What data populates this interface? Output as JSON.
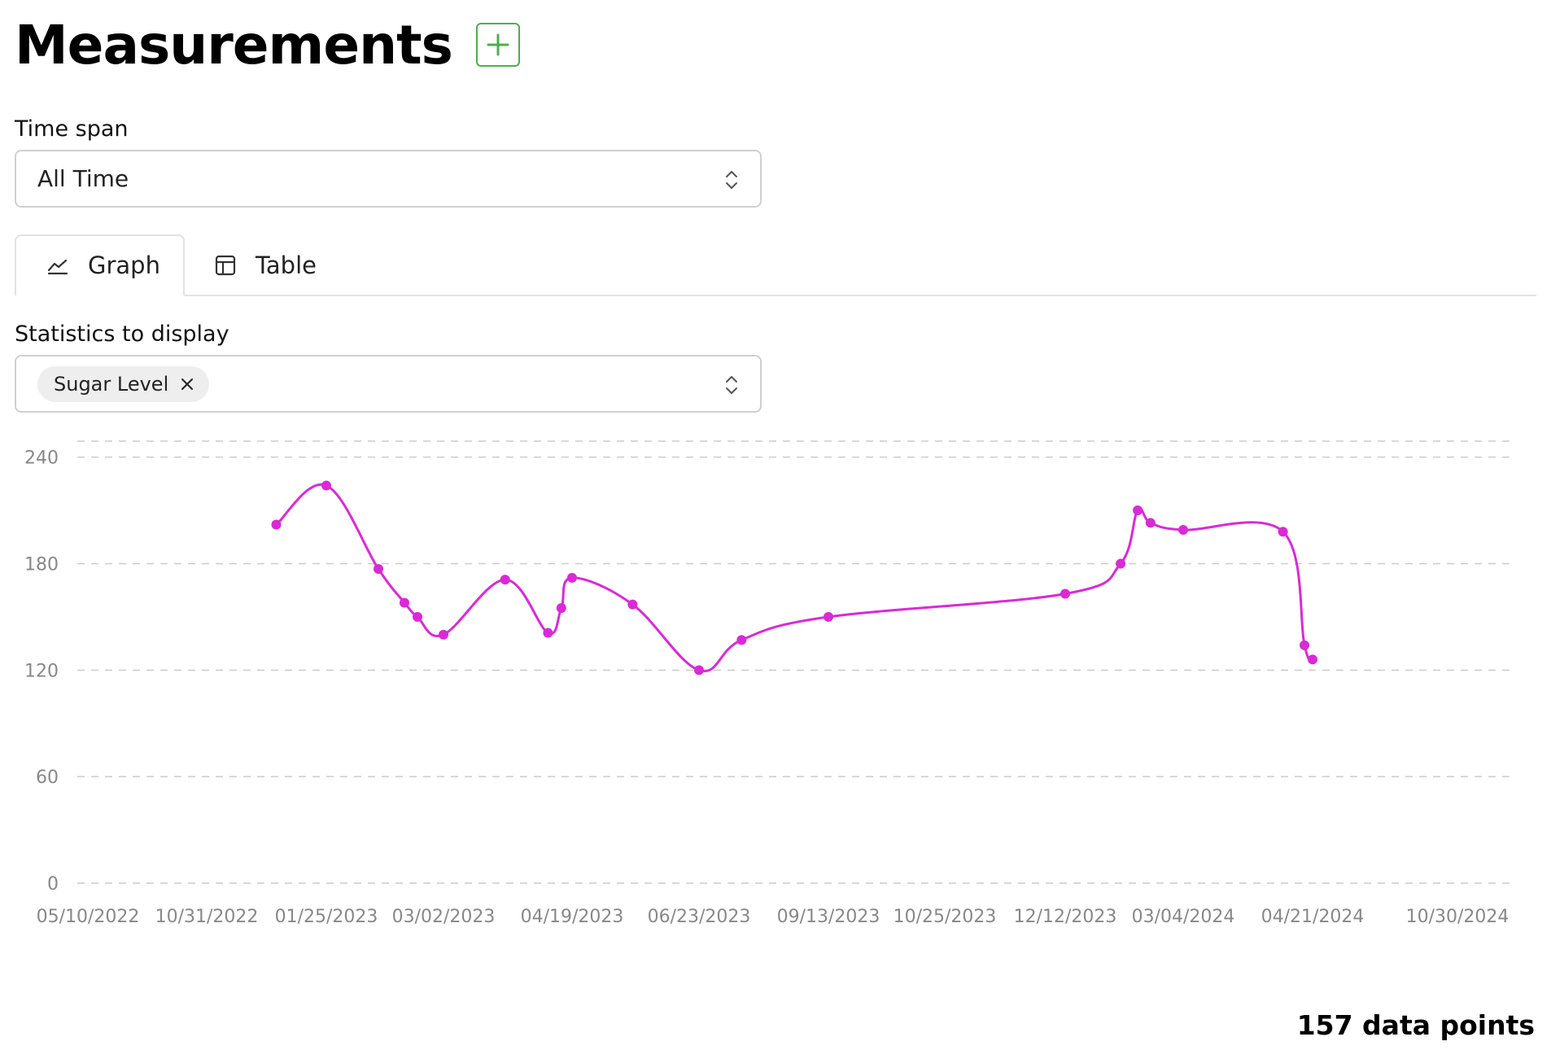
{
  "header": {
    "title": "Measurements",
    "add_button_icon": "plus-icon",
    "add_button_color": "#4caf50"
  },
  "time_span": {
    "label": "Time span",
    "selected": "All Time",
    "icon": "chevron-up-down-icon"
  },
  "tabs": [
    {
      "label": "Graph",
      "icon": "area-chart-icon",
      "active": true
    },
    {
      "label": "Table",
      "icon": "table-icon",
      "active": false
    }
  ],
  "statistics": {
    "label": "Statistics to display",
    "selected_chips": [
      {
        "label": "Sugar Level",
        "remove_icon": "close-icon"
      }
    ],
    "icon": "chevron-up-down-icon"
  },
  "chart_data": {
    "type": "line",
    "line_color": "#d92ad6",
    "grid": true,
    "grid_style": "dashed",
    "ylim": [
      0,
      240
    ],
    "y_ticks": [
      "0",
      "60",
      "120",
      "180",
      "240"
    ],
    "x_ticks": [
      "05/10/2022",
      "10/31/2022",
      "01/25/2023",
      "03/02/2023",
      "04/19/2023",
      "06/23/2023",
      "09/13/2023",
      "10/25/2023",
      "12/12/2023",
      "03/04/2024",
      "04/21/2024",
      "10/30/2024"
    ],
    "series": [
      {
        "points": [
          {
            "x": "12/20/2022",
            "y": 202
          },
          {
            "x": "01/25/2023",
            "y": 224
          },
          {
            "x": "02/10/2023",
            "y": 177
          },
          {
            "x": "02/18/2023",
            "y": 158
          },
          {
            "x": "02/22/2023",
            "y": 150
          },
          {
            "x": "03/02/2023",
            "y": 140
          },
          {
            "x": "03/25/2023",
            "y": 171
          },
          {
            "x": "04/10/2023",
            "y": 141
          },
          {
            "x": "04/15/2023",
            "y": 155
          },
          {
            "x": "04/19/2023",
            "y": 172
          },
          {
            "x": "05/20/2023",
            "y": 157
          },
          {
            "x": "06/23/2023",
            "y": 120
          },
          {
            "x": "07/20/2023",
            "y": 137
          },
          {
            "x": "09/13/2023",
            "y": 150
          },
          {
            "x": "12/12/2023",
            "y": 163
          },
          {
            "x": "01/20/2024",
            "y": 180
          },
          {
            "x": "02/01/2024",
            "y": 210
          },
          {
            "x": "02/10/2024",
            "y": 203
          },
          {
            "x": "03/04/2024",
            "y": 199
          },
          {
            "x": "04/10/2024",
            "y": 198
          },
          {
            "x": "04/18/2024",
            "y": 134
          },
          {
            "x": "04/21/2024",
            "y": 126
          }
        ]
      }
    ]
  },
  "footer": {
    "count_text": "157 data points"
  }
}
